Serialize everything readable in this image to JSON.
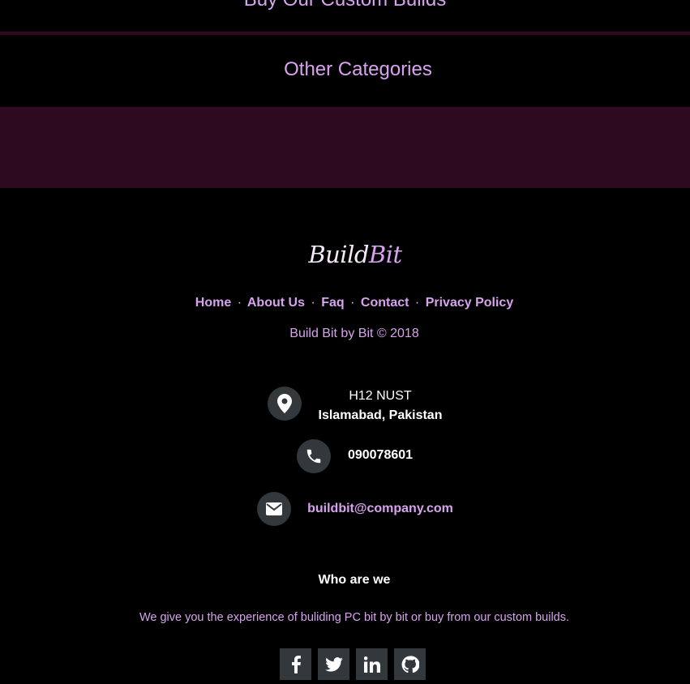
{
  "sections": {
    "top_heading": "Buy Our Custom Builds",
    "other_categories": "Other Categories"
  },
  "footer": {
    "logo": {
      "part1": "Build",
      "part2": "Bit"
    },
    "links": [
      {
        "label": "Home"
      },
      {
        "label": "About Us"
      },
      {
        "label": "Faq"
      },
      {
        "label": "Contact"
      },
      {
        "label": "Privacy Policy"
      }
    ],
    "separator": "·",
    "copyright": "Build Bit by Bit © 2018",
    "contact": {
      "address_line1": "H12 NUST",
      "address_line2": "Islamabad, Pakistan",
      "phone": "090078601",
      "email": "buildbit@company.com"
    },
    "about": {
      "title": "Who are we",
      "text": "We give you the experience of buliding PC bit by bit or buy from our custom builds."
    },
    "social_icons": [
      "facebook-icon",
      "twitter-icon",
      "linkedin-icon",
      "github-icon"
    ]
  },
  "colors": {
    "accent": "#d8a3ee",
    "band": "#2e0a21",
    "icon_bg": "#33383d",
    "background": "#000000"
  }
}
